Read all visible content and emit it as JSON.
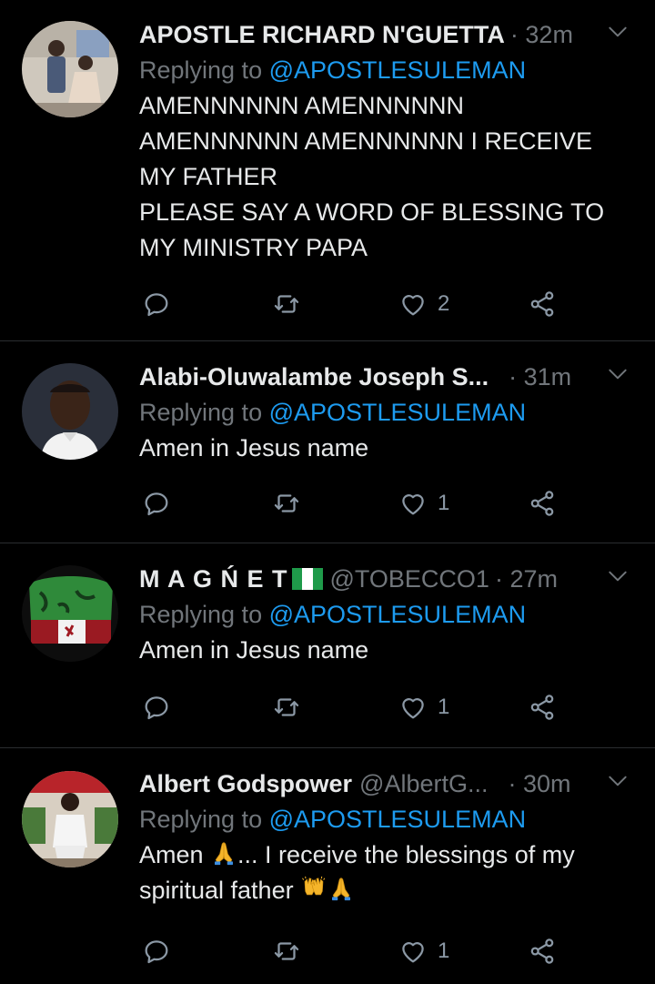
{
  "tweets": [
    {
      "name": "APOSTLE RICHARD N'GUETTA",
      "handle": "",
      "time": "· 32m",
      "replying_prefix": "Replying to ",
      "replying_handle": "@APOSTLESULEMAN",
      "lines": [
        "AMENNNNNN AMENNNNNN",
        "AMENNNNNN AMENNNNNN I RECEIVE",
        "MY FATHER",
        "PLEASE SAY A WORD OF BLESSING TO",
        "MY MINISTRY PAPA"
      ],
      "likes": "2"
    },
    {
      "name": "Alabi-Oluwalambe Joseph S...",
      "handle": "",
      "time": "· 31m",
      "replying_prefix": "Replying to ",
      "replying_handle": "@APOSTLESULEMAN",
      "lines": [
        "Amen in Jesus name"
      ],
      "likes": "1"
    },
    {
      "name": "M A G Ń E T",
      "handle": "@TOBECCO1",
      "time": "· 27m",
      "replying_prefix": "Replying to ",
      "replying_handle": "@APOSTLESULEMAN",
      "lines": [
        "Amen in Jesus name"
      ],
      "likes": "1"
    },
    {
      "name": "Albert Godspower",
      "handle": "@AlbertG...",
      "time": "· 30m",
      "replying_prefix": "Replying to ",
      "replying_handle": "@APOSTLESULEMAN",
      "line1_a": "Amen ",
      "line1_b": "... I receive the blessings of my",
      "line2": "spiritual father ",
      "likes": "1"
    }
  ],
  "icons": {
    "reply": "reply-icon",
    "retweet": "retweet-icon",
    "like": "heart-icon",
    "share": "share-icon",
    "more": "chevron-down-icon",
    "emoji_pray": "folded-hands-emoji",
    "emoji_raise": "raising-hands-emoji",
    "flag": "nigeria-flag-emoji"
  },
  "colors": {
    "background": "#000000",
    "link": "#1d9bf0",
    "muted": "#71767b",
    "text": "#e7e9ea"
  }
}
